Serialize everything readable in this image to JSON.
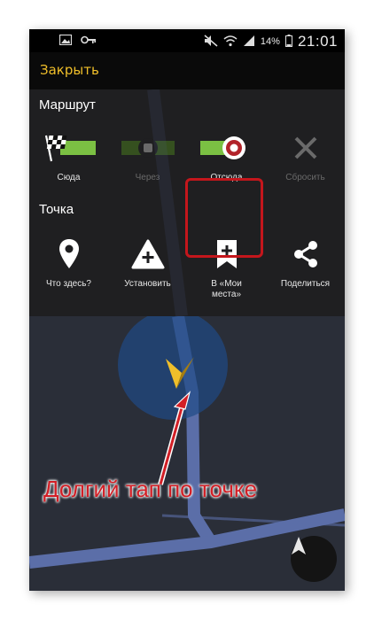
{
  "status_bar": {
    "battery": "14%",
    "time": "21:01"
  },
  "top_bar": {
    "close_label": "Закрыть"
  },
  "route_section": {
    "title": "Маршрут",
    "actions": [
      {
        "label": "Сюда",
        "icon": "checkered-flag-icon",
        "enabled": true
      },
      {
        "label": "Через",
        "icon": "waypoint-icon",
        "enabled": false
      },
      {
        "label": "Отсюда",
        "icon": "start-point-icon",
        "enabled": true
      },
      {
        "label": "Сбросить",
        "icon": "close-icon",
        "enabled": false
      }
    ]
  },
  "point_section": {
    "title": "Точка",
    "actions": [
      {
        "label": "Что здесь?",
        "icon": "map-pin-icon"
      },
      {
        "label": "Установить",
        "icon": "add-warning-icon"
      },
      {
        "label": "В «Мои места»",
        "icon": "bookmark-add-icon"
      },
      {
        "label": "Поделиться",
        "icon": "share-icon"
      }
    ]
  },
  "annotation": {
    "text": "Долгий тап по точке",
    "color": "#d21f26"
  },
  "colors": {
    "accent": "#f0bf2a",
    "route_green": "#7bc043",
    "highlight": "#c4161c",
    "road": "#5b6ea8"
  }
}
